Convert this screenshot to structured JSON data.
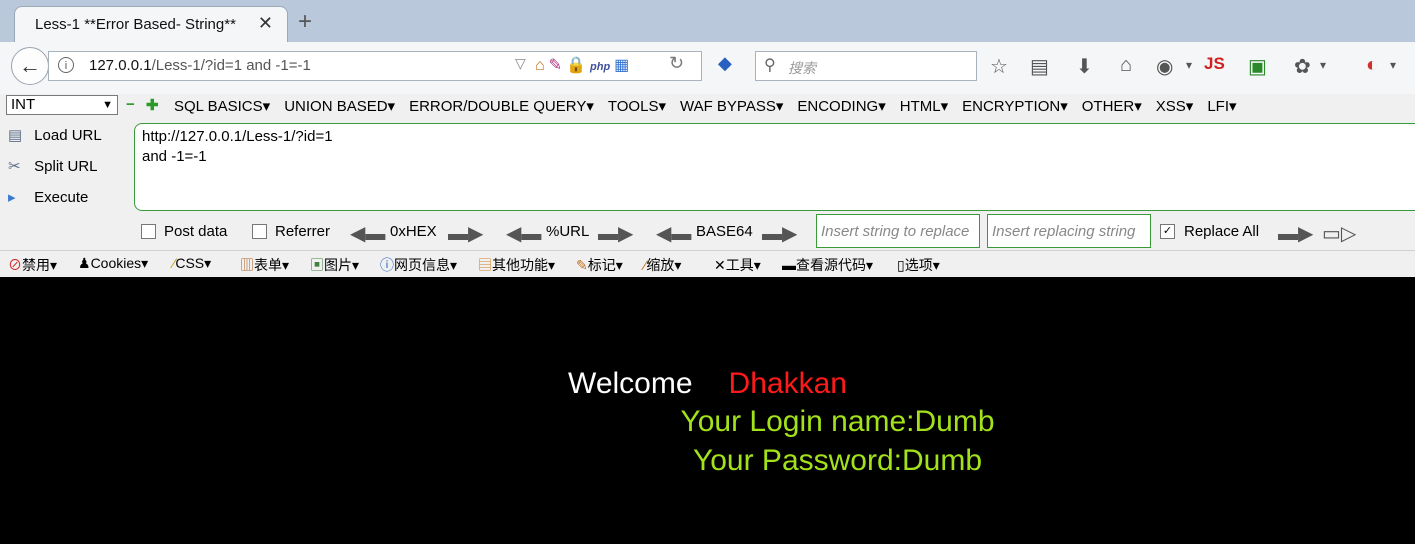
{
  "tab": {
    "title": "Less-1 **Error Based- String**",
    "close": "✕",
    "new_tab": "+"
  },
  "nav": {
    "url_host": "127.0.0.1",
    "url_path": "/Less-1/?id=1 and -1=-1",
    "search_placeholder": "搜索"
  },
  "hackbar": {
    "select_value": "INT",
    "menus": [
      "SQL BASICS▾",
      "UNION BASED▾",
      "ERROR/DOUBLE QUERY▾",
      "TOOLS▾",
      "WAF BYPASS▾",
      "ENCODING▾",
      "HTML▾",
      "ENCRYPTION▾",
      "OTHER▾",
      "XSS▾",
      "LFI▾"
    ],
    "load_url": "Load URL",
    "split_url": "Split URL",
    "execute": "Execute",
    "url_line1": "http://127.0.0.1/Less-1/?id=1",
    "url_line2": " and -1=-1",
    "post_data": "Post data",
    "referrer": "Referrer",
    "hex": "0xHEX",
    "url_enc": "%URL",
    "base64": "BASE64",
    "replace_placeholder": "Insert string to replace",
    "replacing_placeholder": "Insert replacing string",
    "replace_all": "Replace All",
    "post_checked": false,
    "referrer_checked": false,
    "replace_all_checked": true
  },
  "toolbar2": [
    "禁用▾",
    "Cookies▾",
    "CSS▾",
    "表单▾",
    "图片▾",
    "网页信息▾",
    "其他功能▾",
    "标记▾",
    "缩放▾",
    "工具▾",
    "查看源代码▾",
    "选项▾"
  ],
  "page": {
    "welcome": "Welcome",
    "user_name": "Dhakkan",
    "login_line": "Your Login name:Dumb",
    "password_line": "Your Password:Dumb"
  }
}
